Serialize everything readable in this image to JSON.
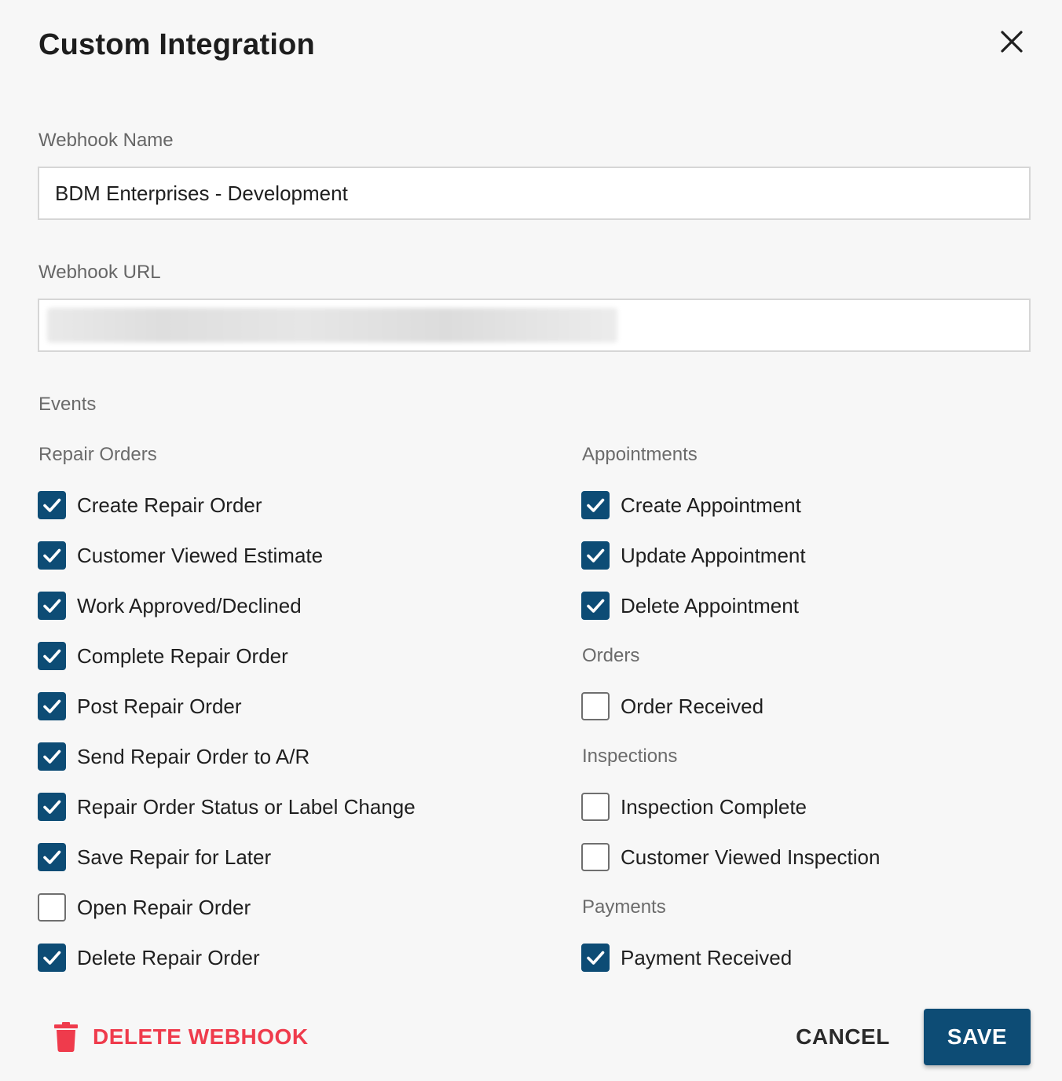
{
  "dialog": {
    "title": "Custom Integration"
  },
  "webhook_name": {
    "label": "Webhook Name",
    "value": "BDM Enterprises - Development"
  },
  "webhook_url": {
    "label": "Webhook URL",
    "value": ""
  },
  "events": {
    "label": "Events",
    "repair_orders": {
      "heading": "Repair Orders",
      "items": [
        {
          "label": "Create Repair Order",
          "checked": true
        },
        {
          "label": "Customer Viewed Estimate",
          "checked": true
        },
        {
          "label": "Work Approved/Declined",
          "checked": true
        },
        {
          "label": "Complete Repair Order",
          "checked": true
        },
        {
          "label": "Post Repair Order",
          "checked": true
        },
        {
          "label": "Send Repair Order to A/R",
          "checked": true
        },
        {
          "label": "Repair Order Status or Label Change",
          "checked": true
        },
        {
          "label": "Save Repair for Later",
          "checked": true
        },
        {
          "label": "Open Repair Order",
          "checked": false
        },
        {
          "label": "Delete Repair Order",
          "checked": true
        }
      ]
    },
    "appointments": {
      "heading": "Appointments",
      "items": [
        {
          "label": "Create Appointment",
          "checked": true
        },
        {
          "label": "Update Appointment",
          "checked": true
        },
        {
          "label": "Delete Appointment",
          "checked": true
        }
      ]
    },
    "orders": {
      "heading": "Orders",
      "items": [
        {
          "label": "Order Received",
          "checked": false
        }
      ]
    },
    "inspections": {
      "heading": "Inspections",
      "items": [
        {
          "label": "Inspection Complete",
          "checked": false
        },
        {
          "label": "Customer Viewed Inspection",
          "checked": false
        }
      ]
    },
    "payments": {
      "heading": "Payments",
      "items": [
        {
          "label": "Payment Received",
          "checked": true
        }
      ]
    }
  },
  "footer": {
    "delete_label": "DELETE WEBHOOK",
    "cancel_label": "CANCEL",
    "save_label": "SAVE"
  },
  "colors": {
    "primary": "#0d4c75",
    "danger": "#ef3b4c",
    "background": "#f7f7f7"
  }
}
